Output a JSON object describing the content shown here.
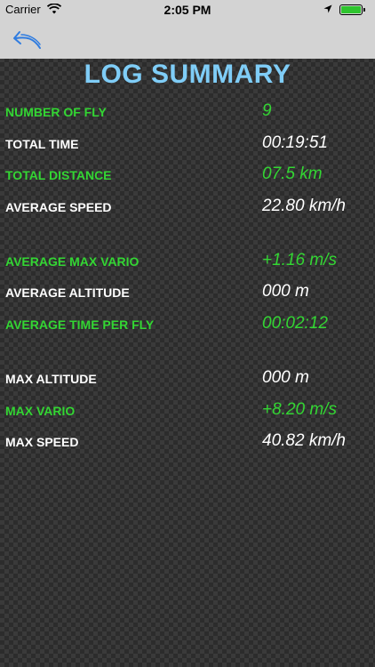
{
  "status_bar": {
    "carrier": "Carrier",
    "time": "2:05 PM",
    "icons": [
      "wifi-icon",
      "location-arrow-icon",
      "battery-icon"
    ]
  },
  "nav": {
    "back_icon": "back-arrow-icon",
    "accent_color": "#2f7ce0"
  },
  "title": "LOG SUMMARY",
  "colors": {
    "title": "#7fcdf7",
    "green_text": "#33d633",
    "white_text": "#ffffff"
  },
  "rows": [
    {
      "label": "NUMBER OF FLY",
      "value": "9",
      "color": "green"
    },
    {
      "label": "TOTAL TIME",
      "value": "00:19:51",
      "color": "white"
    },
    {
      "label": "TOTAL DISTANCE",
      "value": "07.5 km",
      "color": "green"
    },
    {
      "label": "AVERAGE SPEED",
      "value": "22.80 km/h",
      "color": "white"
    },
    {
      "label": "AVERAGE MAX VARIO",
      "value": "+1.16 m/s",
      "color": "green"
    },
    {
      "label": "AVERAGE ALTITUDE",
      "value": "000 m",
      "color": "white"
    },
    {
      "label": "AVERAGE TIME PER FLY",
      "value": "00:02:12",
      "color": "green"
    },
    {
      "label": "MAX ALTITUDE",
      "value": "000 m",
      "color": "white"
    },
    {
      "label": "MAX VARIO",
      "value": "+8.20 m/s",
      "color": "green"
    },
    {
      "label": "MAX SPEED",
      "value": "40.82 km/h",
      "color": "white"
    }
  ]
}
